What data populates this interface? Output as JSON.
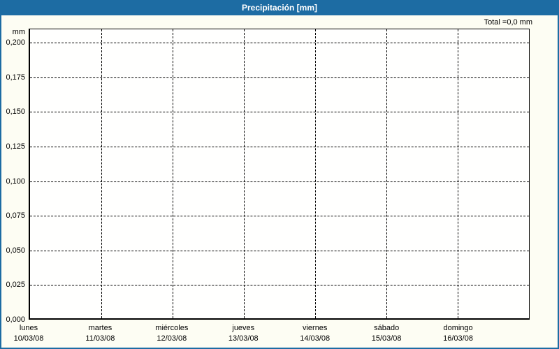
{
  "window": {
    "title": "Precipitación [mm]",
    "colors": {
      "titlebar_blue": "#1d6ca3",
      "frame_blue": "#1d6ca3",
      "background": "#fdfdf3",
      "plot_background": "#fffffe",
      "grid_color": "#000000",
      "text_color": "#000000",
      "title_text_color": "#ffffff"
    }
  },
  "chart_data": {
    "type": "bar",
    "title": "Precipitación [mm]",
    "total_label": "Total =0,0 mm",
    "total_mm": 0.0,
    "y_axis_unit": "mm",
    "ylabel": "mm",
    "xlabel": "",
    "ylim": [
      0.0,
      0.21
    ],
    "grid": "dashed",
    "legend": "none",
    "y_ticks": [
      {
        "value": 0.2,
        "label": "0,200"
      },
      {
        "value": 0.175,
        "label": "0,175"
      },
      {
        "value": 0.15,
        "label": "0,150"
      },
      {
        "value": 0.125,
        "label": "0,125"
      },
      {
        "value": 0.1,
        "label": "0,100"
      },
      {
        "value": 0.075,
        "label": "0,075"
      },
      {
        "value": 0.05,
        "label": "0,050"
      },
      {
        "value": 0.025,
        "label": "0,025"
      },
      {
        "value": 0.0,
        "label": "0,000"
      }
    ],
    "categories": [
      "lunes 10/03/08",
      "martes 11/03/08",
      "miércoles 12/03/08",
      "jueves 13/03/08",
      "viernes 14/03/08",
      "sábado 15/03/08",
      "domingo 16/03/08"
    ],
    "days": [
      {
        "name": "lunes",
        "date": "10/03/08",
        "value": 0.0
      },
      {
        "name": "martes",
        "date": "11/03/08",
        "value": 0.0
      },
      {
        "name": "miércoles",
        "date": "12/03/08",
        "value": 0.0
      },
      {
        "name": "jueves",
        "date": "13/03/08",
        "value": 0.0
      },
      {
        "name": "viernes",
        "date": "14/03/08",
        "value": 0.0
      },
      {
        "name": "sábado",
        "date": "15/03/08",
        "value": 0.0
      },
      {
        "name": "domingo",
        "date": "16/03/08",
        "value": 0.0
      }
    ],
    "values": [
      0.0,
      0.0,
      0.0,
      0.0,
      0.0,
      0.0,
      0.0
    ]
  }
}
